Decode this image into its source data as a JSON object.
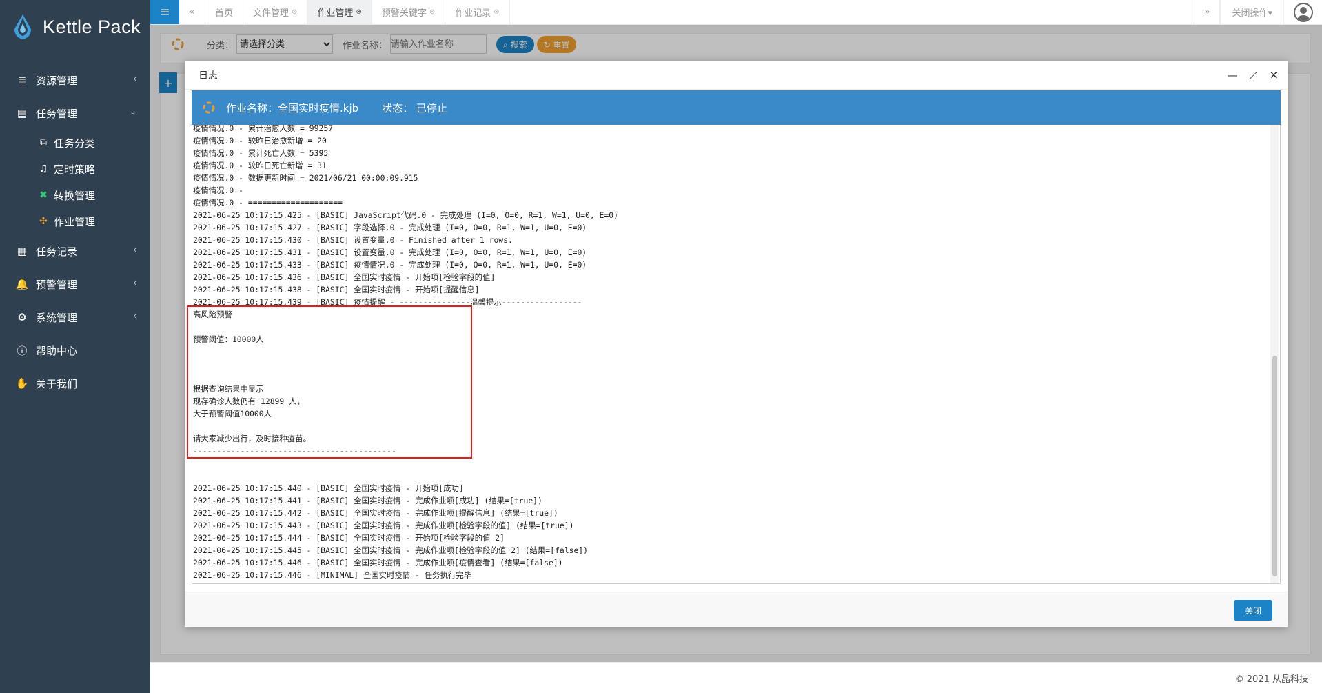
{
  "brand": {
    "name": "Kettle Pack"
  },
  "sidebar": {
    "items": [
      {
        "label": "资源管理",
        "icon": "database-icon",
        "glyph": "≣",
        "arrow": "‹"
      },
      {
        "label": "任务管理",
        "icon": "tasks-icon",
        "glyph": "▤",
        "arrow": "⌄"
      },
      {
        "label": "任务记录",
        "icon": "calendar-icon",
        "glyph": "▦",
        "arrow": "‹"
      },
      {
        "label": "预警管理",
        "icon": "bell-icon",
        "glyph": "🔔",
        "arrow": "‹"
      },
      {
        "label": "系统管理",
        "icon": "gears-icon",
        "glyph": "⚙",
        "arrow": "‹"
      },
      {
        "label": "帮助中心",
        "icon": "question-circle-icon",
        "glyph": "ⓘ"
      },
      {
        "label": "关于我们",
        "icon": "handshake-icon",
        "glyph": "✋"
      }
    ],
    "subitems": [
      {
        "label": "任务分类",
        "icon": "copy-icon",
        "glyph": "⧉",
        "color": "#ffffff"
      },
      {
        "label": "定时策略",
        "icon": "bell-outline-icon",
        "glyph": "♫",
        "color": "#ffffff"
      },
      {
        "label": "转换管理",
        "icon": "transform-icon",
        "glyph": "✖",
        "color": "#2ecc71"
      },
      {
        "label": "作业管理",
        "icon": "job-icon",
        "glyph": "✣",
        "color": "#f0a030"
      }
    ]
  },
  "topbar": {
    "menu_icon": "≡",
    "back_icon": "«",
    "forward_icon": "»",
    "tabs": [
      {
        "label": "首页",
        "closable": false
      },
      {
        "label": "文件管理",
        "closable": true
      },
      {
        "label": "作业管理",
        "closable": true,
        "active": true
      },
      {
        "label": "预警关键字",
        "closable": true
      },
      {
        "label": "作业记录",
        "closable": true
      }
    ],
    "close_x": "⊗",
    "close_ops_label": "关闭操作▾"
  },
  "filter": {
    "category_label": "分类：",
    "category_value": "请选择分类",
    "job_name_label": "作业名称：",
    "job_name_placeholder": "请输入作业名称",
    "search_label": "搜索",
    "reset_label": "重置",
    "add_label": "+"
  },
  "dialog": {
    "title": "日志",
    "minimize": "—",
    "maximize": "⤢",
    "close": "✕",
    "job_name_text": "作业名称：全国实时疫情.kjb",
    "status_text": "状态： 已停止",
    "close_button": "关闭",
    "log_lines": [
      "疫情情况.0 - 累计治愈人数 = 99257",
      "疫情情况.0 - 较昨日治愈新增 = 20",
      "疫情情况.0 - 累计死亡人数 = 5395",
      "疫情情况.0 - 较昨日死亡新增 = 31",
      "疫情情况.0 - 数据更新时间 = 2021/06/21 00:00:09.915",
      "疫情情况.0 -",
      "疫情情况.0 - ====================",
      "2021-06-25 10:17:15.425 - [BASIC] JavaScript代码.0 - 完成处理 (I=0, O=0, R=1, W=1, U=0, E=0)",
      "2021-06-25 10:17:15.427 - [BASIC] 字段选择.0 - 完成处理 (I=0, O=0, R=1, W=1, U=0, E=0)",
      "2021-06-25 10:17:15.430 - [BASIC] 设置变量.0 - Finished after 1 rows.",
      "2021-06-25 10:17:15.431 - [BASIC] 设置变量.0 - 完成处理 (I=0, O=0, R=1, W=1, U=0, E=0)",
      "2021-06-25 10:17:15.433 - [BASIC] 疫情情况.0 - 完成处理 (I=0, O=0, R=1, W=1, U=0, E=0)",
      "2021-06-25 10:17:15.436 - [BASIC] 全国实时疫情 - 开始项[检验字段的值]",
      "2021-06-25 10:17:15.438 - [BASIC] 全国实时疫情 - 开始项[提醒信息]",
      "2021-06-25 10:17:15.439 - [BASIC] 疫情提醒 - ---------------温馨提示-----------------",
      "高风险预警",
      "",
      "预警阈值：10000人",
      "",
      "",
      "",
      "根据查询结果中显示",
      "现存确诊人数仍有 12899 人，",
      "大于预警阈值10000人",
      "",
      "请大家减少出行，及时接种疫苗。",
      "-------------------------------------------",
      "",
      "",
      "2021-06-25 10:17:15.440 - [BASIC] 全国实时疫情 - 开始项[成功]",
      "2021-06-25 10:17:15.441 - [BASIC] 全国实时疫情 - 完成作业项[成功] (结果=[true])",
      "2021-06-25 10:17:15.442 - [BASIC] 全国实时疫情 - 完成作业项[提醒信息] (结果=[true])",
      "2021-06-25 10:17:15.443 - [BASIC] 全国实时疫情 - 完成作业项[检验字段的值] (结果=[true])",
      "2021-06-25 10:17:15.444 - [BASIC] 全国实时疫情 - 开始项[检验字段的值 2]",
      "2021-06-25 10:17:15.445 - [BASIC] 全国实时疫情 - 完成作业项[检验字段的值 2] (结果=[false])",
      "2021-06-25 10:17:15.446 - [BASIC] 全国实时疫情 - 完成作业项[疫情查看] (结果=[false])",
      "2021-06-25 10:17:15.446 - [MINIMAL] 全国实时疫情 - 任务执行完毕"
    ]
  },
  "footer": {
    "copyright": "© 2021 从晶科技"
  },
  "colors": {
    "sidebar_bg": "#2f4050",
    "primary": "#1c84c6",
    "header_blue": "#3a89c9",
    "highlight_red": "#e21b1b",
    "reset_orange": "#f0a030"
  }
}
